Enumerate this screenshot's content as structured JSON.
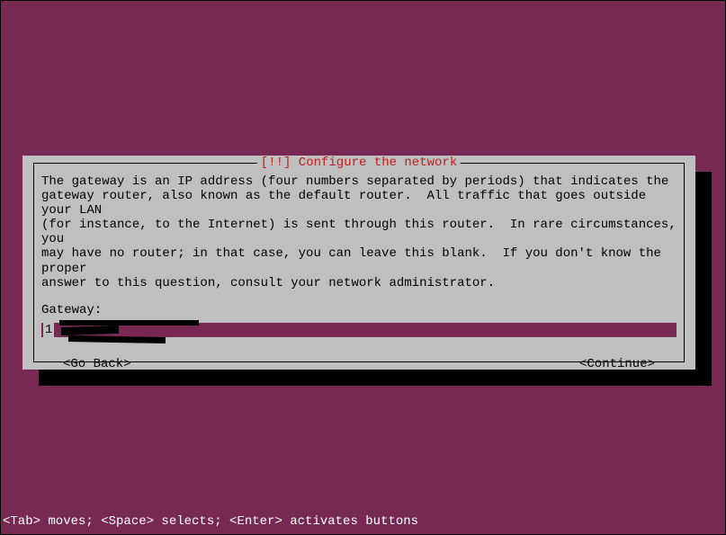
{
  "dialog": {
    "title": "[!!] Configure the network",
    "helpText": "The gateway is an IP address (four numbers separated by periods) that indicates the\ngateway router, also known as the default router.  All traffic that goes outside your LAN\n(for instance, to the Internet) is sent through this router.  In rare circumstances, you\nmay have no router; in that case, you can leave this blank.  If you don't know the proper\nanswer to this question, consult your network administrator.",
    "fieldLabel": "Gateway:",
    "inputValue": "1",
    "buttons": {
      "back": "<Go Back>",
      "continue": "<Continue>"
    }
  },
  "statusbar": "<Tab> moves; <Space> selects; <Enter> activates buttons"
}
